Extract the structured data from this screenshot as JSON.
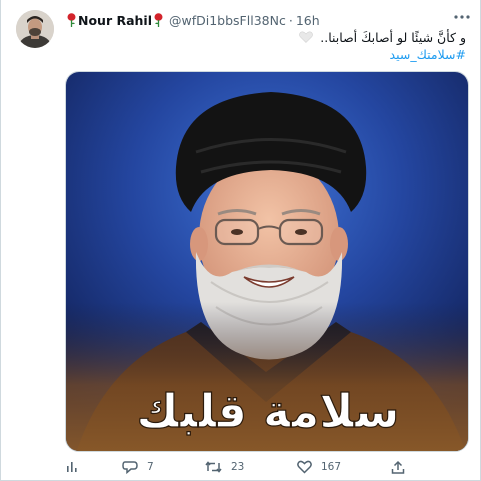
{
  "tweet": {
    "author_name": "Nour Rahil",
    "author_emoji": "rose-emoji",
    "handle": "@wfDi1bbsFll38Nc",
    "separator": "·",
    "time": "16h",
    "text_line": "و كأنَّ شيئًا لو أصابكَ أصابنا..",
    "text_emoji": "white-heart-emoji",
    "hashtag": "#سلامتك_سيد"
  },
  "media": {
    "overlay_text": "سلامة قلبك",
    "description_icon": "portrait-photo"
  },
  "actions": {
    "analytics_icon": "bar-chart-icon",
    "reply_icon": "comment-icon",
    "reply_count": "7",
    "retweet_icon": "retweet-icon",
    "retweet_count": "23",
    "like_icon": "heart-icon",
    "like_count": "167",
    "share_icon": "share-icon"
  },
  "colors": {
    "accent": "#1d9bf0",
    "muted": "#536471",
    "text": "#0f1419"
  }
}
